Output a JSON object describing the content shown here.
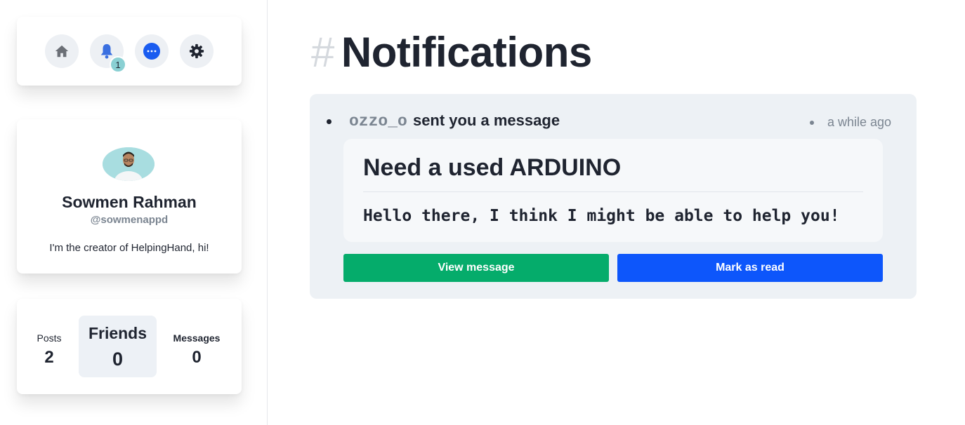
{
  "nav": {
    "items": [
      {
        "name": "home",
        "icon": "home-icon"
      },
      {
        "name": "notifications",
        "icon": "bell-icon",
        "badge": "1"
      },
      {
        "name": "messages",
        "icon": "chat-bubble-icon"
      },
      {
        "name": "settings",
        "icon": "gear-icon"
      }
    ]
  },
  "profile": {
    "name": "Sowmen Rahman",
    "handle": "@sowmenappd",
    "bio": "I'm the creator of HelpingHand, hi!"
  },
  "stats": [
    {
      "label": "Posts",
      "value": "2"
    },
    {
      "label": "Friends",
      "value": "0"
    },
    {
      "label": "Messages",
      "value": "0"
    }
  ],
  "page": {
    "hash": "#",
    "title": "Notifications"
  },
  "notification": {
    "user": "ozzo_o",
    "action": "sent you a message",
    "time": "a while ago",
    "subject": "Need a used ARDUINO",
    "body": "Hello there, I think I might be able to help you!",
    "view_label": "View message",
    "read_label": "Mark as read"
  },
  "colors": {
    "view_button": "#05ac6b",
    "read_button": "#0d56fb",
    "badge": "#8ad0d3",
    "messages_icon": "#1a5cf0"
  }
}
